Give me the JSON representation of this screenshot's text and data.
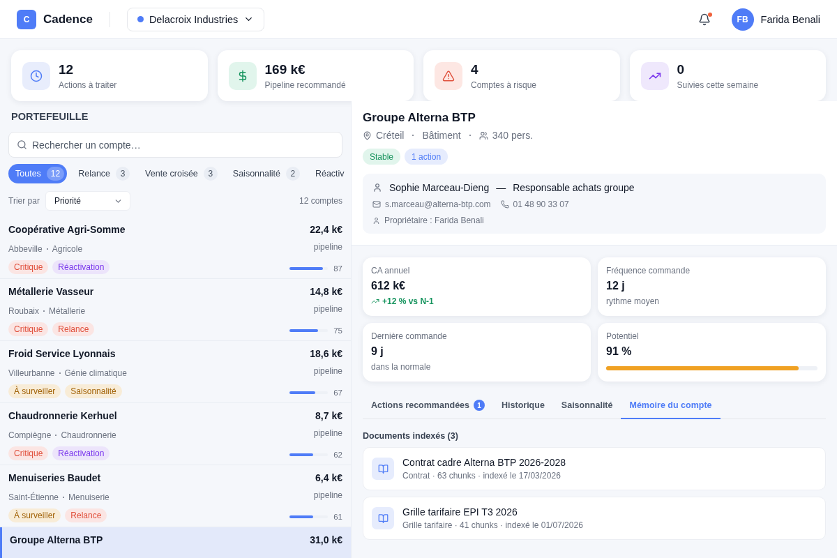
{
  "header": {
    "app_name": "Cadence",
    "logo_letter": "C",
    "organization": "Delacroix Industries",
    "notifications_unread": true,
    "user": {
      "initials": "FB",
      "name": "Farida Benali"
    }
  },
  "stats": [
    {
      "kind": "actions",
      "value": "12",
      "label": "Actions à traiter"
    },
    {
      "kind": "pipeline",
      "value": "169 k€",
      "label": "Pipeline recommandé"
    },
    {
      "kind": "risk",
      "value": "4",
      "label": "Comptes à risque"
    },
    {
      "kind": "follow",
      "value": "0",
      "label": "Suivies cette semaine"
    }
  ],
  "portfolio": {
    "title": "PORTEFEUILLE",
    "search": {
      "placeholder": "Rechercher un compte…"
    },
    "filters": [
      {
        "label": "Toutes",
        "count": "12",
        "selected": true
      },
      {
        "label": "Relance",
        "count": "3",
        "selected": false
      },
      {
        "label": "Vente croisée",
        "count": "3",
        "selected": false
      },
      {
        "label": "Saisonnalité",
        "count": "2",
        "selected": false
      },
      {
        "label": "Réactiv",
        "selected": false
      }
    ],
    "sort": {
      "label": "Trier par",
      "value": "Priorité"
    },
    "count": "12 comptes",
    "accounts": [
      {
        "name": "Coopérative Agri-Somme",
        "city": "Abbeville",
        "sector": "Agricole",
        "amount": "22,4 k€",
        "amount_label": "pipeline",
        "tags": [
          {
            "kind": "red",
            "label": "Critique"
          },
          {
            "kind": "purple",
            "label": "Réactivation"
          }
        ],
        "level": 0.87,
        "score": "87",
        "selected": false
      },
      {
        "name": "Métallerie Vasseur",
        "city": "Roubaix",
        "sector": "Métallerie",
        "amount": "14,8 k€",
        "amount_label": "pipeline",
        "tags": [
          {
            "kind": "red",
            "label": "Critique"
          },
          {
            "kind": "red",
            "label": "Relance"
          }
        ],
        "level": 0.75,
        "score": "75",
        "selected": false
      },
      {
        "name": "Froid Service Lyonnais",
        "city": "Villeurbanne",
        "sector": "Génie climatique",
        "amount": "18,6 k€",
        "amount_label": "pipeline",
        "tags": [
          {
            "kind": "amber",
            "label": "À surveiller"
          },
          {
            "kind": "amber",
            "label": "Saisonnalité"
          }
        ],
        "level": 0.67,
        "score": "67",
        "selected": false
      },
      {
        "name": "Chaudronnerie Kerhuel",
        "city": "Compiègne",
        "sector": "Chaudronnerie",
        "amount": "8,7 k€",
        "amount_label": "pipeline",
        "tags": [
          {
            "kind": "red",
            "label": "Critique"
          },
          {
            "kind": "purple",
            "label": "Réactivation"
          }
        ],
        "level": 0.62,
        "score": "62",
        "selected": false
      },
      {
        "name": "Menuiseries Baudet",
        "city": "Saint-Étienne",
        "sector": "Menuiserie",
        "amount": "6,4 k€",
        "amount_label": "pipeline",
        "tags": [
          {
            "kind": "amber",
            "label": "À surveiller"
          },
          {
            "kind": "red",
            "label": "Relance"
          }
        ],
        "level": 0.61,
        "score": "61",
        "selected": false
      },
      {
        "name": "Groupe Alterna BTP",
        "amount": "31,0 k€",
        "selected": true
      }
    ]
  },
  "detail": {
    "name": "Groupe Alterna BTP",
    "city": "Créteil",
    "sector": "Bâtiment",
    "headcount": "340 pers.",
    "badges": [
      {
        "kind": "green",
        "label": "Stable"
      },
      {
        "kind": "blue",
        "label": "1 action"
      }
    ],
    "contact": {
      "name": "Sophie Marceau-Dieng",
      "separator": "—",
      "role": "Responsable achats groupe",
      "email": "s.marceau@alterna-btp.com",
      "phone": "01 48 90 33 07",
      "owner": "Propriétaire : Farida Benali"
    },
    "metrics": [
      {
        "kind": "trend",
        "label": "CA annuel",
        "value": "612 k€",
        "note": "+12 % vs N-1"
      },
      {
        "kind": "text",
        "label": "Fréquence commande",
        "value": "12 j",
        "note": "rythme moyen"
      },
      {
        "kind": "text",
        "label": "Dernière commande",
        "value": "9 j",
        "note": "dans la normale"
      },
      {
        "kind": "bar",
        "label": "Potentiel",
        "value": "91 %",
        "level": 0.91
      }
    ],
    "tabs": [
      {
        "label": "Actions recommandées",
        "badge": "1",
        "selected": false
      },
      {
        "label": "Historique",
        "selected": false
      },
      {
        "label": "Saisonnalité",
        "selected": false
      },
      {
        "label": "Mémoire du compte",
        "selected": true
      }
    ],
    "documents_title": "Documents indexés (3)",
    "documents": [
      {
        "title": "Contrat cadre Alterna BTP 2026-2028",
        "meta": "Contrat · 63 chunks · indexé le 17/03/2026"
      },
      {
        "title": "Grille tarifaire EPI T3 2026",
        "meta": "Grille tarifaire · 41 chunks · indexé le 01/07/2026"
      }
    ]
  }
}
